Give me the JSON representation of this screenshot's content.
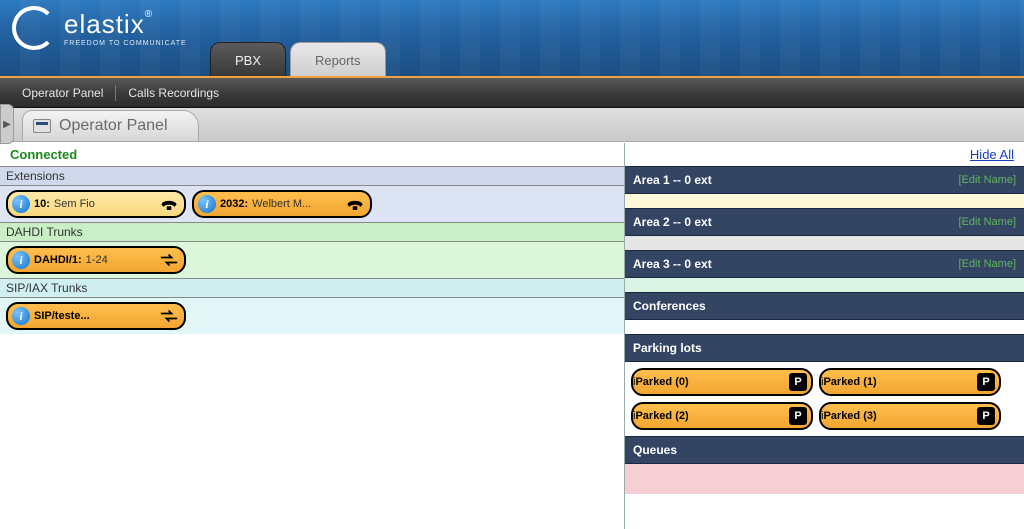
{
  "brand": {
    "name": "elastix",
    "tagline": "FREEDOM TO COMMUNICATE"
  },
  "mainTabs": {
    "active": "PBX",
    "other": "Reports"
  },
  "subnav": {
    "item1": "Operator Panel",
    "item2": "Calls Recordings"
  },
  "pageTab": "Operator Panel",
  "status": {
    "connected": "Connected",
    "hideAll": "Hide All"
  },
  "sections": {
    "extensions": {
      "title": "Extensions",
      "items": [
        {
          "num": "10:",
          "name": "Sem Fio"
        },
        {
          "num": "2032:",
          "name": "Welbert M..."
        }
      ]
    },
    "dahdi": {
      "title": "DAHDI Trunks",
      "items": [
        {
          "num": "DAHDI/1:",
          "name": "1-24"
        }
      ]
    },
    "sip": {
      "title": "SIP/IAX Trunks",
      "items": [
        {
          "num": "SIP/teste...",
          "name": ""
        }
      ]
    }
  },
  "areas": [
    {
      "label": "Area 1 -- 0 ext",
      "edit": "[Edit Name]"
    },
    {
      "label": "Area 2 -- 0 ext",
      "edit": "[Edit Name]"
    },
    {
      "label": "Area 3 -- 0 ext",
      "edit": "[Edit Name]"
    }
  ],
  "conferences": {
    "title": "Conferences"
  },
  "parking": {
    "title": "Parking lots",
    "items": [
      {
        "label": "Parked (0)"
      },
      {
        "label": "Parked (1)"
      },
      {
        "label": "Parked (2)"
      },
      {
        "label": "Parked (3)"
      }
    ]
  },
  "queues": {
    "title": "Queues"
  }
}
